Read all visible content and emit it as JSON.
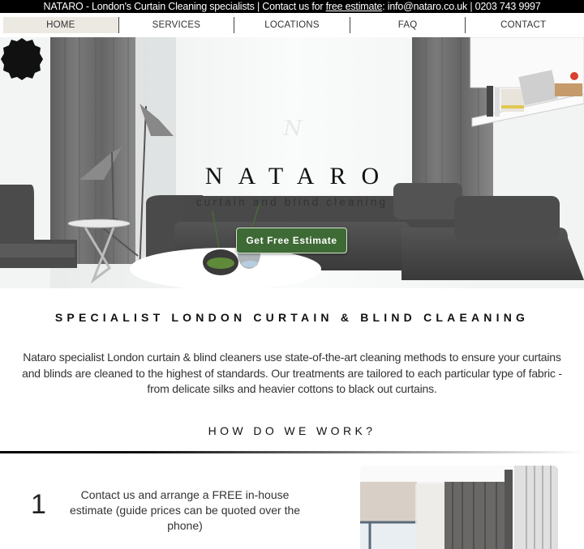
{
  "topbar": {
    "prefix": "NATARO - London's Curtain Cleaning specialists | Contact us for ",
    "link": "free estimate",
    "suffix": ": info@nataro.co.uk | 0203 743 9997"
  },
  "nav": {
    "items": [
      {
        "label": "HOME",
        "active": true
      },
      {
        "label": "SERVICES"
      },
      {
        "label": "LOCATIONS"
      },
      {
        "label": "FAQ"
      },
      {
        "label": "CONTACT"
      }
    ]
  },
  "hero": {
    "logo_letter": "N",
    "brand_name": "NATARO",
    "tagline": "curtain and blind cleaning",
    "cta_label": "Get Free Estimate",
    "cta_color": "#3e6a35"
  },
  "intro": {
    "heading": "SPECIALIST LONDON CURTAIN & BLIND CLAEANING",
    "body": "Nataro specialist London curtain & blind cleaners use state-of-the-art cleaning methods to ensure your curtains and blinds are cleaned to the highest of standards. Our treatments are tailored to each particular type of fabric - from delicate silks and heavier cottons to black out curtains."
  },
  "how": {
    "heading": "HOW DO WE WORK?",
    "steps": [
      {
        "number": "1",
        "text": "Contact us and arrange a FREE in-house estimate (guide prices can be quoted over the phone)"
      }
    ]
  }
}
